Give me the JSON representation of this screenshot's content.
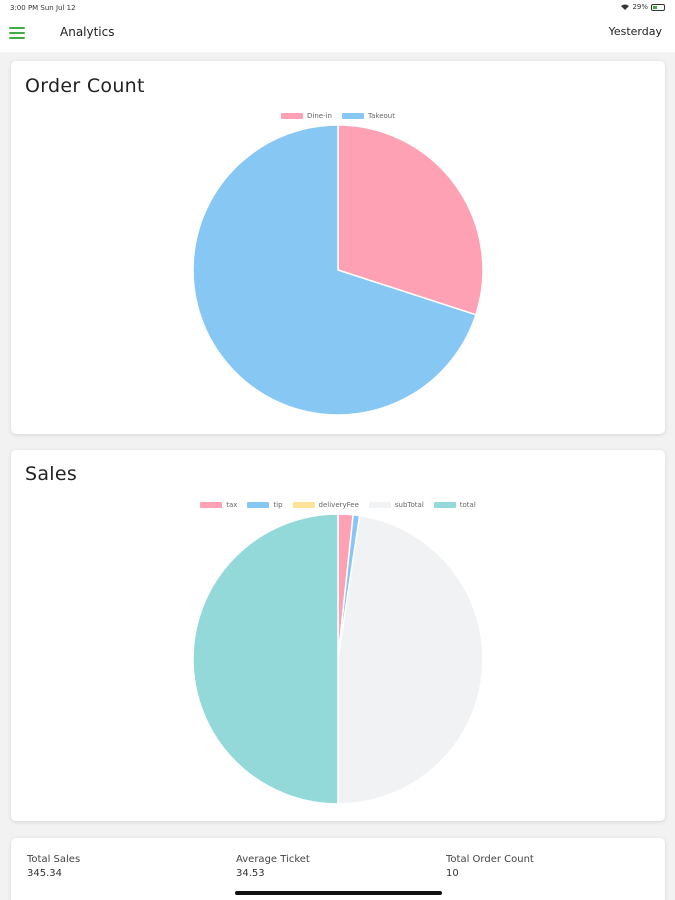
{
  "status_bar": {
    "time": "3:00 PM  Sun Jul 12",
    "battery": "29%"
  },
  "header": {
    "title": "Analytics",
    "date_filter": "Yesterday"
  },
  "order_card": {
    "title": "Order Count"
  },
  "sales_card": {
    "title": "Sales"
  },
  "summary": {
    "total_sales_label": "Total Sales",
    "total_sales_value": "345.34",
    "avg_ticket_label": "Average Ticket",
    "avg_ticket_value": "34.53",
    "order_count_label": "Total Order Count",
    "order_count_value": "10"
  },
  "chart_data": [
    {
      "type": "pie",
      "title": "Order Count",
      "categories": [
        "Dine-in",
        "Takeout"
      ],
      "values": [
        3,
        7
      ],
      "colors": [
        "#ffa1b5",
        "#86c7f3"
      ],
      "legend_position": "top"
    },
    {
      "type": "pie",
      "title": "Sales",
      "categories": [
        "tax",
        "tip",
        "deliveryFee",
        "subTotal",
        "total"
      ],
      "values": [
        11.5,
        5.0,
        0,
        328.84,
        345.34
      ],
      "colors": [
        "#ffa1b5",
        "#86c7f3",
        "#ffe29a",
        "#f1f2f4",
        "#93d9d9"
      ],
      "legend_position": "top"
    }
  ]
}
